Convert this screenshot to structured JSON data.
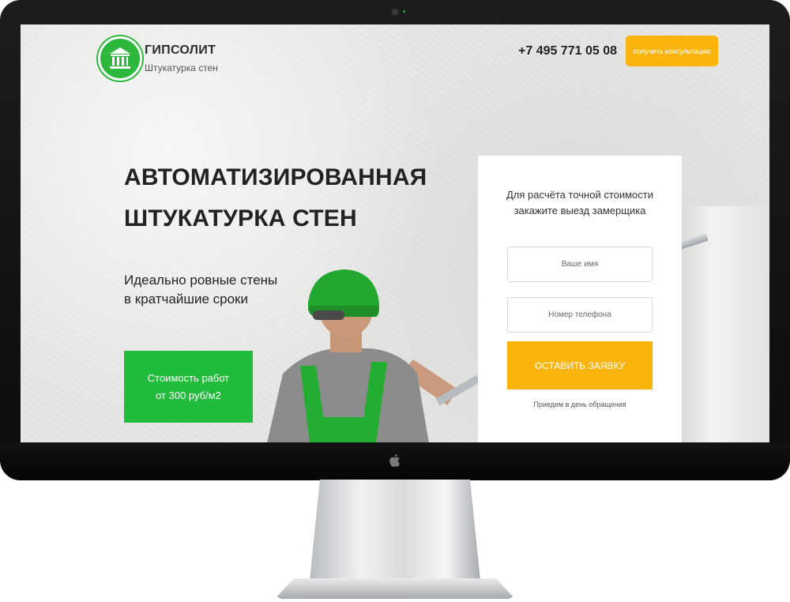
{
  "header": {
    "brand_name": "ГИПСОЛИТ",
    "brand_tagline": "Штукатурка стен",
    "phone": "+7 495 771 05 08",
    "consult_button": "получить консультацию"
  },
  "hero": {
    "title_line1": "АВТОМАТИЗИРОВАННАЯ",
    "title_line2": "ШТУКАТУРКА СТЕН",
    "subtitle_line1": "Идеально ровные стены",
    "subtitle_line2": "в кратчайшие сроки",
    "price_line1": "Стоимость работ",
    "price_line2": "от 300 руб/м2"
  },
  "form": {
    "heading_line1": "Для расчёта точной стоимости",
    "heading_line2": "закажите выезд замерщика",
    "name_placeholder": "Ваше имя",
    "phone_placeholder": "Номер телефона",
    "submit_label": "ОСТАВИТЬ ЗАЯВКУ",
    "note": "Приедем в день обращения"
  },
  "colors": {
    "brand_green": "#22bc3c",
    "accent_orange": "#fbb40b",
    "text_dark": "#222222"
  },
  "icons": {
    "logo": "building-columns-icon",
    "device": "apple-logo-icon"
  }
}
